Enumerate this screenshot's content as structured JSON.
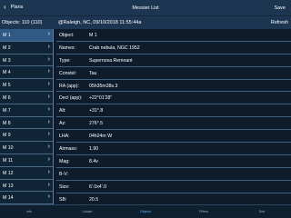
{
  "navbar": {
    "back_label": "Plans",
    "title": "Messier List",
    "save_label": "Save"
  },
  "subbar": {
    "object_count": "Objects: 110 (110)",
    "location": "@Raleigh, NC, 09/10/2018 11:55:44a",
    "refresh_label": "Refresh"
  },
  "list": {
    "items": [
      "M 1",
      "M 2",
      "M 3",
      "M 4",
      "M 5",
      "M 6",
      "M 7",
      "M 8",
      "M 9",
      "M 10",
      "M 11",
      "M 12",
      "M 13",
      "M 14"
    ],
    "selected": "M 1"
  },
  "details": {
    "rows": [
      {
        "label": "Object:",
        "value": "M 1"
      },
      {
        "label": "Names:",
        "value": "Crab nebula, NGC 1952"
      },
      {
        "label": "Type:",
        "value": "Supernova Remnant"
      },
      {
        "label": "Constel:",
        "value": "Tau"
      },
      {
        "label": "RA (app):",
        "value": "05h35m38s.3"
      },
      {
        "label": "Decl (app):",
        "value": "+22°01'28\""
      },
      {
        "label": "Alt:",
        "value": "+31°.8"
      },
      {
        "label": "Az:",
        "value": "276°.5"
      },
      {
        "label": "LHA:",
        "value": "04h24m W"
      },
      {
        "label": "Airmass:",
        "value": "1.90"
      },
      {
        "label": "Mag:",
        "value": "8.4v"
      },
      {
        "label": "B-V:",
        "value": ""
      },
      {
        "label": "Size:",
        "value": "6'.0x4'.0"
      },
      {
        "label": "SB:",
        "value": "20.5"
      },
      {
        "label": "PA:",
        "value": ""
      }
    ]
  },
  "tabs": [
    {
      "label": "Info",
      "active": false
    },
    {
      "label": "Locate",
      "active": false
    },
    {
      "label": "Objects",
      "active": true
    },
    {
      "label": "Filters",
      "active": false
    },
    {
      "label": "Sort",
      "active": false
    }
  ],
  "colors": {
    "navbar": "#1c3550",
    "selected_row": "#2f5a85",
    "background": "#0d1b2b",
    "active_tab": "#6fa8e8"
  }
}
